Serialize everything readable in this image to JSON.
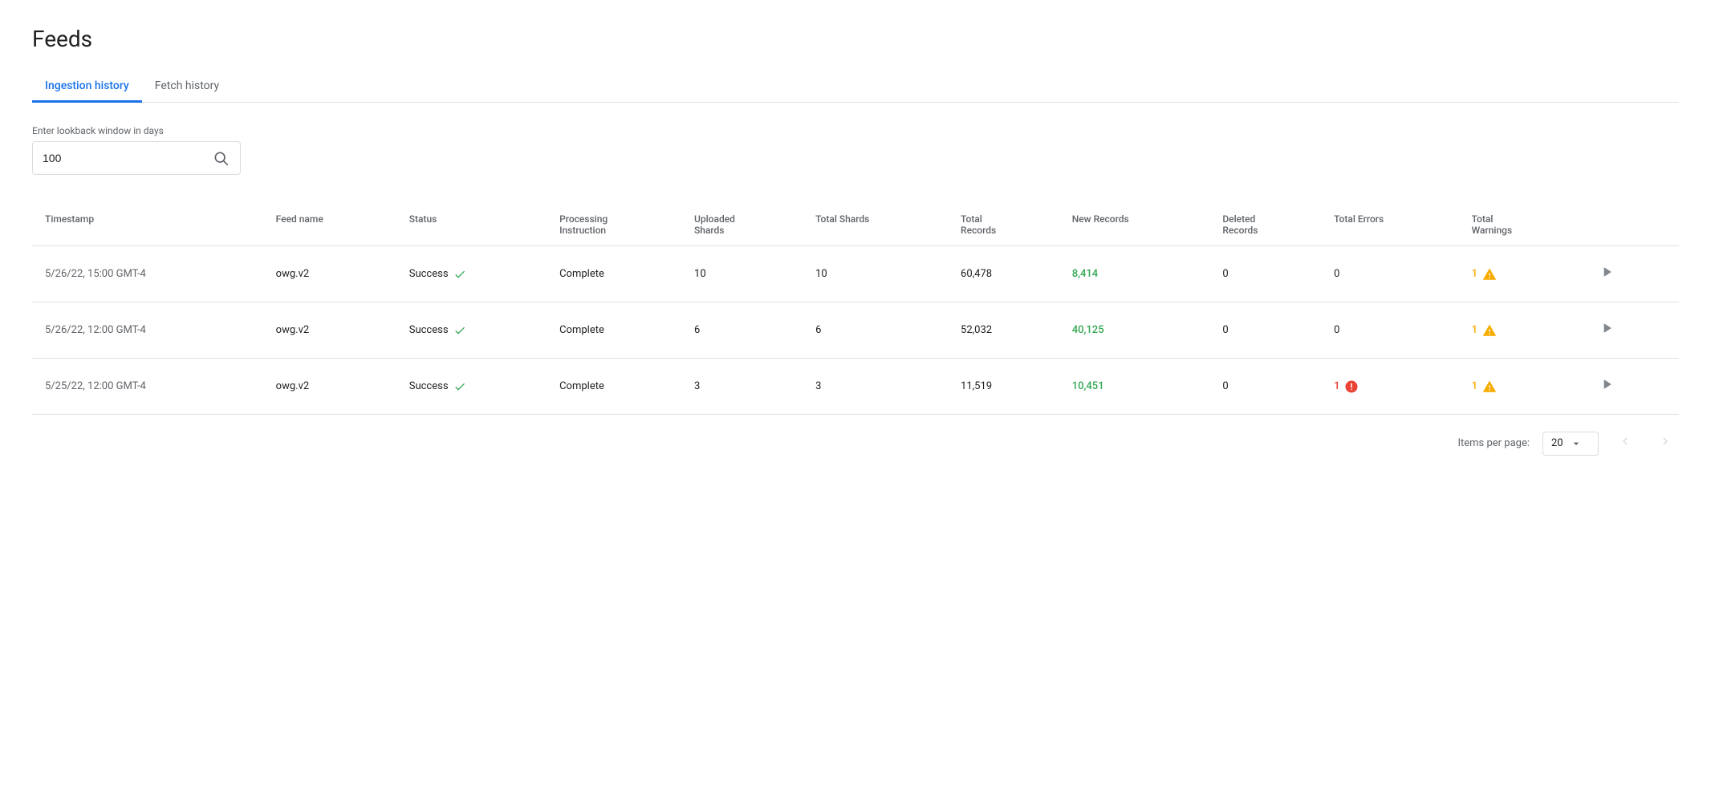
{
  "page": {
    "title": "Feeds"
  },
  "tabs": [
    {
      "id": "ingestion-history",
      "label": "Ingestion history",
      "active": true
    },
    {
      "id": "fetch-history",
      "label": "Fetch history",
      "active": false
    }
  ],
  "search": {
    "label": "Enter lookback window in days",
    "value": "100",
    "placeholder": ""
  },
  "table": {
    "columns": [
      {
        "id": "timestamp",
        "label": "Timestamp"
      },
      {
        "id": "feed-name",
        "label": "Feed name"
      },
      {
        "id": "status",
        "label": "Status"
      },
      {
        "id": "processing-instruction",
        "label": "Processing Instruction"
      },
      {
        "id": "uploaded-shards",
        "label": "Uploaded Shards"
      },
      {
        "id": "total-shards",
        "label": "Total Shards"
      },
      {
        "id": "total-records",
        "label": "Total Records"
      },
      {
        "id": "new-records",
        "label": "New Records"
      },
      {
        "id": "deleted-records",
        "label": "Deleted Records"
      },
      {
        "id": "total-errors",
        "label": "Total Errors"
      },
      {
        "id": "total-warnings",
        "label": "Total Warnings"
      },
      {
        "id": "action",
        "label": ""
      }
    ],
    "rows": [
      {
        "timestamp": "5/26/22, 15:00 GMT-4",
        "feedName": "owg.v2",
        "status": "Success",
        "processingInstruction": "Complete",
        "uploadedShards": "10",
        "totalShards": "10",
        "totalRecords": "60,478",
        "newRecords": "8,414",
        "deletedRecords": "0",
        "totalErrors": "0",
        "totalWarnings": "1",
        "hasWarning": true,
        "hasError": false,
        "errorCount": ""
      },
      {
        "timestamp": "5/26/22, 12:00 GMT-4",
        "feedName": "owg.v2",
        "status": "Success",
        "processingInstruction": "Complete",
        "uploadedShards": "6",
        "totalShards": "6",
        "totalRecords": "52,032",
        "newRecords": "40,125",
        "deletedRecords": "0",
        "totalErrors": "0",
        "totalWarnings": "1",
        "hasWarning": true,
        "hasError": false,
        "errorCount": ""
      },
      {
        "timestamp": "5/25/22, 12:00 GMT-4",
        "feedName": "owg.v2",
        "status": "Success",
        "processingInstruction": "Complete",
        "uploadedShards": "3",
        "totalShards": "3",
        "totalRecords": "11,519",
        "newRecords": "10,451",
        "deletedRecords": "0",
        "totalErrors": "1",
        "totalWarnings": "1",
        "hasWarning": true,
        "hasError": true,
        "errorCount": "1"
      }
    ]
  },
  "pagination": {
    "itemsPerPageLabel": "Items per page:",
    "itemsPerPage": "20",
    "prevDisabled": true,
    "nextDisabled": true
  }
}
